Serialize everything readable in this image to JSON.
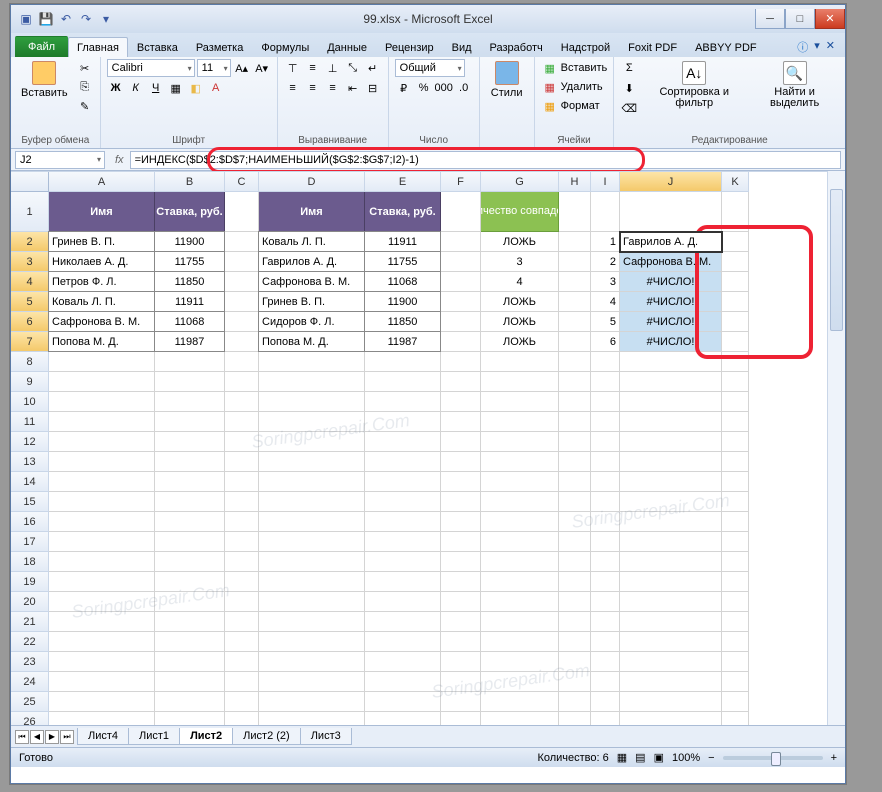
{
  "title": "99.xlsx - Microsoft Excel",
  "qat": [
    "excel",
    "save",
    "undo",
    "redo"
  ],
  "tabs": [
    "Файл",
    "Главная",
    "Вставка",
    "Разметка",
    "Формулы",
    "Данные",
    "Рецензир",
    "Вид",
    "Разработч",
    "Надстрой",
    "Foxit PDF",
    "ABBYY PDF"
  ],
  "active_tab": 1,
  "ribbon": {
    "clipboard": {
      "paste": "Вставить",
      "label": "Буфер обмена"
    },
    "font": {
      "name": "Calibri",
      "size": "11",
      "label": "Шрифт"
    },
    "align": {
      "label": "Выравнивание"
    },
    "number": {
      "fmt": "Общий",
      "label": "Число"
    },
    "styles": {
      "btn": "Стили"
    },
    "cells": {
      "insert": "Вставить",
      "delete": "Удалить",
      "format": "Формат",
      "label": "Ячейки"
    },
    "editing": {
      "sort": "Сортировка и фильтр",
      "find": "Найти и выделить",
      "label": "Редактирование"
    }
  },
  "name_box": "J2",
  "formula": "=ИНДЕКС($D$2:$D$7;НАИМЕНЬШИЙ($G$2:$G$7;I2)-1)",
  "columns": [
    "A",
    "B",
    "C",
    "D",
    "E",
    "F",
    "G",
    "H",
    "I",
    "J",
    "K"
  ],
  "headers": {
    "t1": {
      "A": "Имя",
      "B": "Ставка, руб.",
      "D": "Имя",
      "E": "Ставка, руб."
    },
    "t2": {
      "G": "Количество совпадений"
    }
  },
  "rows": [
    {
      "n": 2,
      "A": "Гринев В. П.",
      "B": "11900",
      "D": "Коваль Л. П.",
      "E": "11911",
      "G": "ЛОЖЬ",
      "I": "1",
      "J": "Гаврилов А. Д."
    },
    {
      "n": 3,
      "A": "Николаев А. Д.",
      "B": "11755",
      "D": "Гаврилов А. Д.",
      "E": "11755",
      "G": "3",
      "I": "2",
      "J": "Сафронова В. М."
    },
    {
      "n": 4,
      "A": "Петров Ф. Л.",
      "B": "11850",
      "D": "Сафронова В. М.",
      "E": "11068",
      "G": "4",
      "I": "3",
      "J": "#ЧИСЛО!"
    },
    {
      "n": 5,
      "A": "Коваль Л. П.",
      "B": "11911",
      "D": "Гринев В. П.",
      "E": "11900",
      "G": "ЛОЖЬ",
      "I": "4",
      "J": "#ЧИСЛО!"
    },
    {
      "n": 6,
      "A": "Сафронова В. М.",
      "B": "11068",
      "D": "Сидоров Ф. Л.",
      "E": "11850",
      "G": "ЛОЖЬ",
      "I": "5",
      "J": "#ЧИСЛО!"
    },
    {
      "n": 7,
      "A": "Попова М. Д.",
      "B": "11987",
      "D": "Попова М. Д.",
      "E": "11987",
      "G": "ЛОЖЬ",
      "I": "6",
      "J": "#ЧИСЛО!"
    }
  ],
  "empty_rows": [
    8,
    9,
    10,
    11,
    12,
    13,
    14,
    15,
    16,
    17,
    18,
    19,
    20,
    21,
    22,
    23,
    24,
    25,
    26
  ],
  "sheets": [
    "Лист4",
    "Лист1",
    "Лист2",
    "Лист2 (2)",
    "Лист3"
  ],
  "active_sheet": 2,
  "status": {
    "ready": "Готово",
    "count": "Количество: 6",
    "zoom": "100%"
  }
}
